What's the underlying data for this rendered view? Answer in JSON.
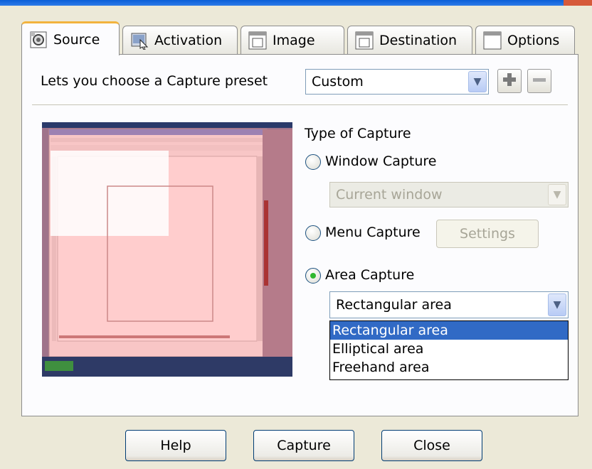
{
  "tabs": [
    {
      "label": "Source",
      "icon": "camera-icon",
      "active": true
    },
    {
      "label": "Activation",
      "icon": "activation-icon"
    },
    {
      "label": "Image",
      "icon": "image-icon"
    },
    {
      "label": "Destination",
      "icon": "destination-icon"
    },
    {
      "label": "Options",
      "icon": "options-icon"
    }
  ],
  "preset": {
    "label": "Lets you choose a Capture preset",
    "value": "Custom",
    "add_icon": "plus-icon",
    "remove_icon": "minus-icon"
  },
  "capture": {
    "type_label": "Type of Capture",
    "window_label": "Window Capture",
    "window_combo": "Current window",
    "menu_label": "Menu Capture",
    "settings_label": "Settings",
    "area_label": "Area Capture",
    "area_combo": "Rectangular area",
    "selected": "area"
  },
  "dropdown": {
    "options": [
      "Rectangular area",
      "Elliptical area",
      "Freehand area"
    ],
    "selected_index": 0
  },
  "buttons": {
    "help": "Help",
    "capture": "Capture",
    "close": "Close"
  },
  "colors": {
    "selection_blue": "#316ac5",
    "tab_highlight": "#f2b33d",
    "capture_overlay": "#ff9c9c",
    "radio_checked": "#2fb72f"
  }
}
